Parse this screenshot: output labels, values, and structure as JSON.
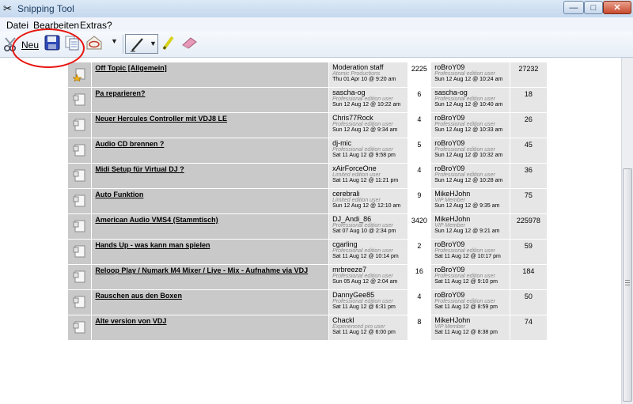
{
  "window": {
    "title": "Snipping Tool",
    "minimize": "—",
    "maximize": "□",
    "close": "✕"
  },
  "menu": {
    "items": [
      "Datei",
      "Bearbeiten",
      "Extras",
      "?"
    ]
  },
  "toolbar": {
    "new_label": "Neu"
  },
  "icons": {
    "app": "scissors-icon",
    "new": "scissors-icon",
    "save": "floppy-disk-icon",
    "copy": "copy-icon",
    "send": "send-email-icon",
    "pen": "pen-icon",
    "highlighter": "highlighter-icon",
    "eraser": "eraser-icon"
  },
  "colors": {
    "annotation": "#e8150f",
    "row_dark": "#c9c9c9",
    "row_light": "#e6e6e6"
  },
  "forum": {
    "rows": [
      {
        "sticky": true,
        "topic": "Off Topic [Allgemein]",
        "starter": {
          "name": "Moderation staff",
          "role": "Atomic Productions",
          "date": "Thu 01 Apr 10 @ 9:20 am"
        },
        "replies": "2225",
        "last": {
          "name": "roBroY09",
          "role": "Professional edition user",
          "date": "Sun 12 Aug 12 @ 10:24 am"
        },
        "views": "27232"
      },
      {
        "sticky": false,
        "topic": "Pa reparieren?",
        "starter": {
          "name": "sascha-og",
          "role": "Professional edition user",
          "date": "Sun 12 Aug 12 @ 10:22 am"
        },
        "replies": "6",
        "last": {
          "name": "sascha-og",
          "role": "Professional edition user",
          "date": "Sun 12 Aug 12 @ 10:40 am"
        },
        "views": "18"
      },
      {
        "sticky": false,
        "topic": "Neuer Hercules Controller mit VDJ8 LE",
        "starter": {
          "name": "Chris77Rock",
          "role": "Professional edition user",
          "date": "Sun 12 Aug 12 @ 9:34 am"
        },
        "replies": "4",
        "last": {
          "name": "roBroY09",
          "role": "Professional edition user",
          "date": "Sun 12 Aug 12 @ 10:33 am"
        },
        "views": "26"
      },
      {
        "sticky": false,
        "topic": "Audio CD brennen ?",
        "starter": {
          "name": "dj-mic",
          "role": "Professional edition user",
          "date": "Sat 11 Aug 12 @ 9:58 pm"
        },
        "replies": "5",
        "last": {
          "name": "roBroY09",
          "role": "Professional edition user",
          "date": "Sun 12 Aug 12 @ 10:32 am"
        },
        "views": "45"
      },
      {
        "sticky": false,
        "topic": "Midi Setup für Virtual DJ ?",
        "starter": {
          "name": "xAirForceOne",
          "role": "Limited edition user",
          "date": "Sat 11 Aug 12 @ 11:21 pm"
        },
        "replies": "4",
        "last": {
          "name": "roBroY09",
          "role": "Professional edition user",
          "date": "Sun 12 Aug 12 @ 10:28 am"
        },
        "views": "36"
      },
      {
        "sticky": false,
        "topic": "Auto Funktion",
        "starter": {
          "name": "cerebrali",
          "role": "Limited edition user",
          "date": "Sun 12 Aug 12 @ 12:10 am"
        },
        "replies": "9",
        "last": {
          "name": "MikeHJohn",
          "role": "VIP Member",
          "date": "Sun 12 Aug 12 @ 9:35 am"
        },
        "views": "75"
      },
      {
        "sticky": false,
        "topic": "American Audio VMS4 (Stammtisch)",
        "starter": {
          "name": "DJ_Andi_86",
          "role": "Professional edition user",
          "date": "Sat 07 Aug 10 @ 2:34 pm"
        },
        "replies": "3420",
        "last": {
          "name": "MikeHJohn",
          "role": "VIP Member",
          "date": "Sun 12 Aug 12 @ 9:21 am"
        },
        "views": "225978"
      },
      {
        "sticky": false,
        "topic": "Hands Up - was kann man spielen",
        "starter": {
          "name": "cgarling",
          "role": "Professional edition user",
          "date": "Sat 11 Aug 12 @ 10:14 pm"
        },
        "replies": "2",
        "last": {
          "name": "roBroY09",
          "role": "Professional edition user",
          "date": "Sat 11 Aug 12 @ 10:17 pm"
        },
        "views": "59"
      },
      {
        "sticky": false,
        "topic": "Reloop Play / Numark M4 Mixer / Live - Mix - Aufnahme via VDJ",
        "starter": {
          "name": "mrbreeze7",
          "role": "Professional edition user",
          "date": "Sun 05 Aug 12 @ 2:04 am"
        },
        "replies": "16",
        "last": {
          "name": "roBroY09",
          "role": "Professional edition user",
          "date": "Sat 11 Aug 12 @ 9:10 pm"
        },
        "views": "184"
      },
      {
        "sticky": false,
        "topic": "Rauschen aus den Boxen",
        "starter": {
          "name": "DannyGee85",
          "role": "Professional edition user",
          "date": "Sat 11 Aug 12 @ 6:31 pm"
        },
        "replies": "4",
        "last": {
          "name": "roBroY09",
          "role": "Professional edition user",
          "date": "Sat 11 Aug 12 @ 8:59 pm"
        },
        "views": "50"
      },
      {
        "sticky": false,
        "topic": "Alte version von VDJ",
        "starter": {
          "name": "Chackl",
          "role": "Experienced pro user",
          "date": "Sat 11 Aug 12 @ 6:00 pm"
        },
        "replies": "8",
        "last": {
          "name": "MikeHJohn",
          "role": "VIP Member",
          "date": "Sat 11 Aug 12 @ 8:38 pm"
        },
        "views": "74"
      }
    ]
  }
}
